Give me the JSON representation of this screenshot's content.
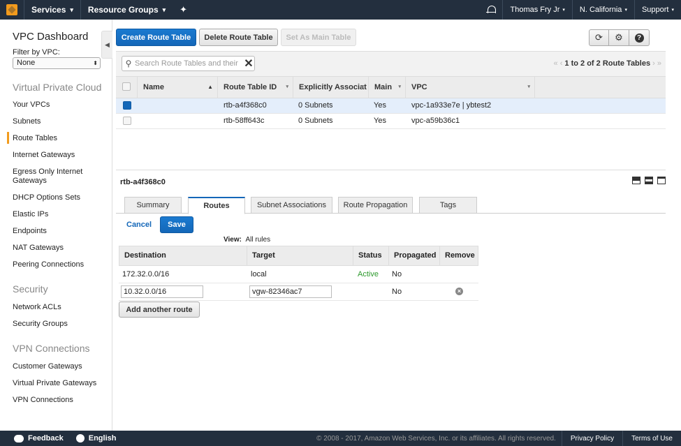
{
  "topnav": {
    "services": "Services",
    "resource_groups": "Resource Groups",
    "user": "Thomas Fry Jr",
    "region": "N. California",
    "support": "Support"
  },
  "sidebar": {
    "title": "VPC Dashboard",
    "filter_label": "Filter by VPC:",
    "filter_value": "None",
    "sections": {
      "vpc": "Virtual Private Cloud",
      "security": "Security",
      "vpn": "VPN Connections"
    },
    "vpc_items": [
      "Your VPCs",
      "Subnets",
      "Route Tables",
      "Internet Gateways",
      "Egress Only Internet Gateways",
      "DHCP Options Sets",
      "Elastic IPs",
      "Endpoints",
      "NAT Gateways",
      "Peering Connections"
    ],
    "security_items": [
      "Network ACLs",
      "Security Groups"
    ],
    "vpn_items": [
      "Customer Gateways",
      "Virtual Private Gateways",
      "VPN Connections"
    ],
    "active_item": "Route Tables"
  },
  "toolbar": {
    "create": "Create Route Table",
    "delete": "Delete Route Table",
    "set_main": "Set As Main Table"
  },
  "search": {
    "placeholder": "Search Route Tables and their"
  },
  "pager": {
    "text": "1 to 2 of 2 Route Tables"
  },
  "grid": {
    "columns": [
      "Name",
      "Route Table ID",
      "Explicitly Associat",
      "Main",
      "VPC"
    ],
    "rows": [
      {
        "name": "",
        "id": "rtb-a4f368c0",
        "assoc": "0 Subnets",
        "main": "Yes",
        "vpc": "vpc-1a933e7e | ybtest2",
        "selected": true
      },
      {
        "name": "",
        "id": "rtb-58ff643c",
        "assoc": "0 Subnets",
        "main": "Yes",
        "vpc": "vpc-a59b36c1",
        "selected": false
      }
    ]
  },
  "detail": {
    "title": "rtb-a4f368c0",
    "tabs": [
      "Summary",
      "Routes",
      "Subnet Associations",
      "Route Propagation",
      "Tags"
    ],
    "active_tab": "Routes",
    "cancel": "Cancel",
    "save": "Save",
    "view_label": "View:",
    "view_value": "All rules",
    "routes_columns": [
      "Destination",
      "Target",
      "Status",
      "Propagated",
      "Remove"
    ],
    "routes": [
      {
        "destination": "172.32.0.0/16",
        "target": "local",
        "status": "Active",
        "propagated": "No"
      },
      {
        "destination": "10.32.0.0/16",
        "target": "vgw-82346ac7",
        "status": "",
        "propagated": "No"
      }
    ],
    "add_route": "Add another route"
  },
  "footer": {
    "feedback": "Feedback",
    "language": "English",
    "copyright": "© 2008 - 2017, Amazon Web Services, Inc. or its affiliates. All rights reserved.",
    "privacy": "Privacy Policy",
    "terms": "Terms of Use"
  },
  "colors": {
    "nav_bg": "#232f3e",
    "primary": "#1467b8",
    "accent": "#f29b1d",
    "active_status": "#2e9a2e"
  }
}
